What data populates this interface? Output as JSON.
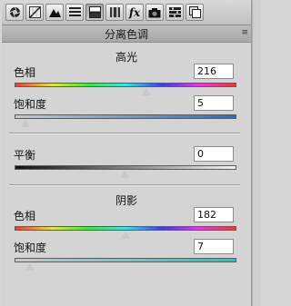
{
  "toolbar": {
    "icons": [
      "aperture-icon",
      "tone-curve-icon",
      "mountain-icon",
      "detail-icon",
      "split-toning-icon",
      "lens-icon",
      "fx-icon",
      "camera-icon",
      "presets-icon",
      "snapshots-icon"
    ],
    "fx_label": "fx",
    "active": "split-toning-icon"
  },
  "header": {
    "title": "分离色调",
    "menu_icon": "≡"
  },
  "highlights": {
    "title": "高光",
    "hue": {
      "label": "色相",
      "value": "216",
      "fraction": 0.6
    },
    "saturation": {
      "label": "饱和度",
      "value": "5",
      "fraction": 0.05
    }
  },
  "balance": {
    "label": "平衡",
    "value": "0",
    "fraction": 0.5
  },
  "shadows": {
    "title": "阴影",
    "hue": {
      "label": "色相",
      "value": "182",
      "fraction": 0.506
    },
    "saturation": {
      "label": "饱和度",
      "value": "7",
      "fraction": 0.07
    }
  },
  "colors": {
    "hue_gradient": [
      "#e53a3a",
      "#e6e63a",
      "#3ae63a",
      "#3ae6e6",
      "#3a3ae6",
      "#e63ae6",
      "#e53a3a"
    ],
    "highlight_sat_gradient": [
      "#c8c8c8",
      "#1f6fd6"
    ],
    "balance_gradient": [
      "#111111",
      "#f2f2f2"
    ],
    "shadow_sat_gradient": [
      "#c8c8c8",
      "#1ec6c6"
    ]
  }
}
